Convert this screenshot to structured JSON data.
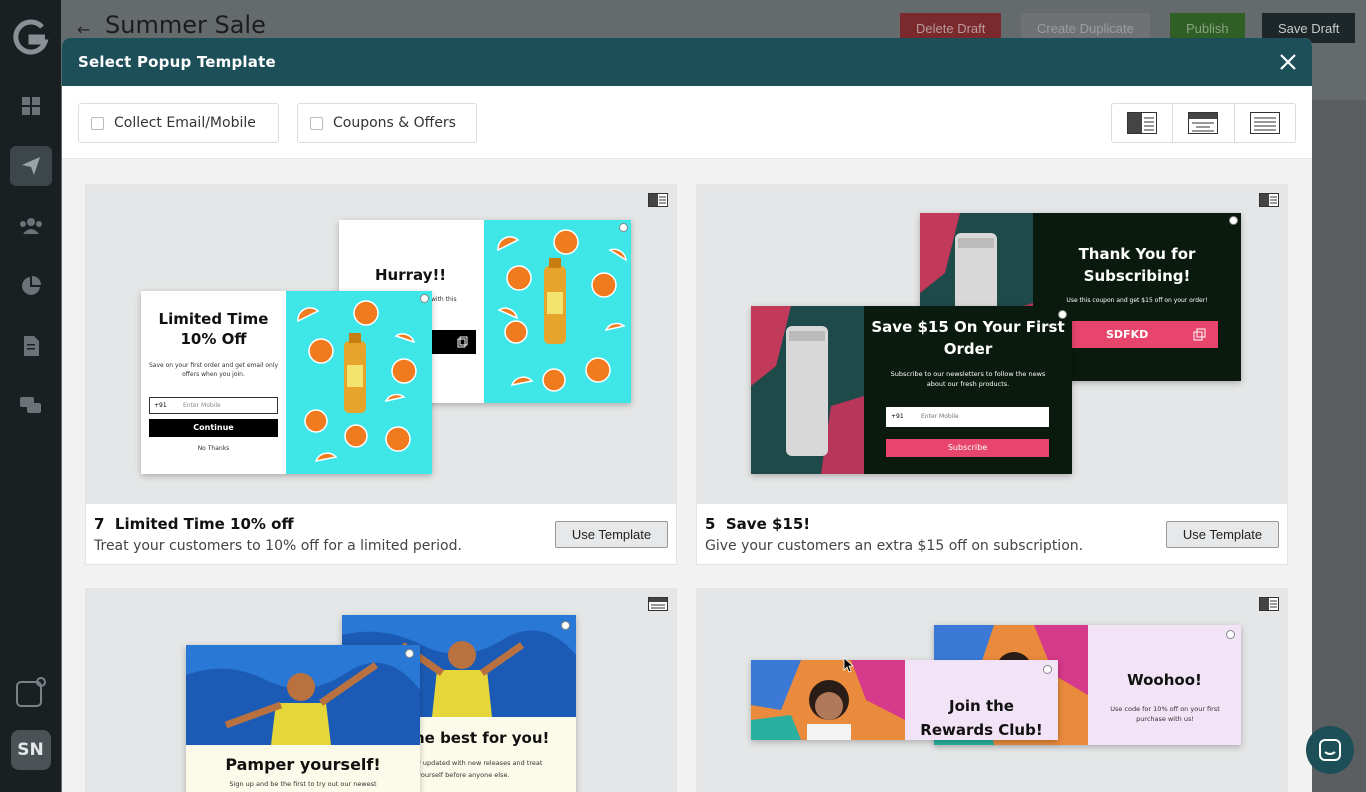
{
  "app": {
    "page_title": "Summer Sale",
    "buttons": {
      "delete": "Delete Draft",
      "duplicate": "Create Duplicate",
      "publish": "Publish",
      "save": "Save Draft"
    },
    "user_initials": "SN"
  },
  "modal": {
    "title": "Select Popup Template",
    "filters": {
      "collect": "Collect Email/Mobile",
      "coupons": "Coupons & Offers"
    }
  },
  "cards": [
    {
      "title": "7  Limited Time 10% off",
      "desc": "Treat your customers to 10% off for a limited period.",
      "btn": "Use Template",
      "back": {
        "title": "Hurray!!",
        "text": "with this"
      },
      "front": {
        "title": "Limited Time 10% Off",
        "text": "Save on your first order and get email only offers when you join.",
        "code": "+91",
        "placeholder": "Enter Mobile",
        "btn": "Continue",
        "skip": "No Thanks"
      }
    },
    {
      "title": "5  Save $15!",
      "desc": "Give your customers an extra $15 off on subscription.",
      "btn": "Use Template",
      "back": {
        "title": "Thank You for Subscribing!",
        "text": "Use this coupon and get $15 off on your order!",
        "code": "SDFKD"
      },
      "front": {
        "title": "Save $15 On Your First Order",
        "text": "Subscribe to our newsletters to follow the news about our fresh products.",
        "code": "+91",
        "placeholder": "Enter Mobile",
        "btn": "Subscribe"
      }
    },
    {
      "back": {
        "title": "he best for you!",
        "text": "y updated with new releases and treat yourself before anyone else."
      },
      "front": {
        "title": "Pamper yourself!",
        "text": "Sign up and be the first to try out our newest"
      }
    },
    {
      "back": {
        "title": "Woohoo!",
        "text": "Use code for 10% off on your first purchase with us!"
      },
      "front": {
        "title": "Join the Rewards Club!"
      }
    }
  ],
  "colors": {
    "header": "#1d4f59",
    "delete": "#a8292b",
    "publish": "#2d7a1e",
    "save": "#1a2a2e",
    "pink": "#e8456c"
  }
}
